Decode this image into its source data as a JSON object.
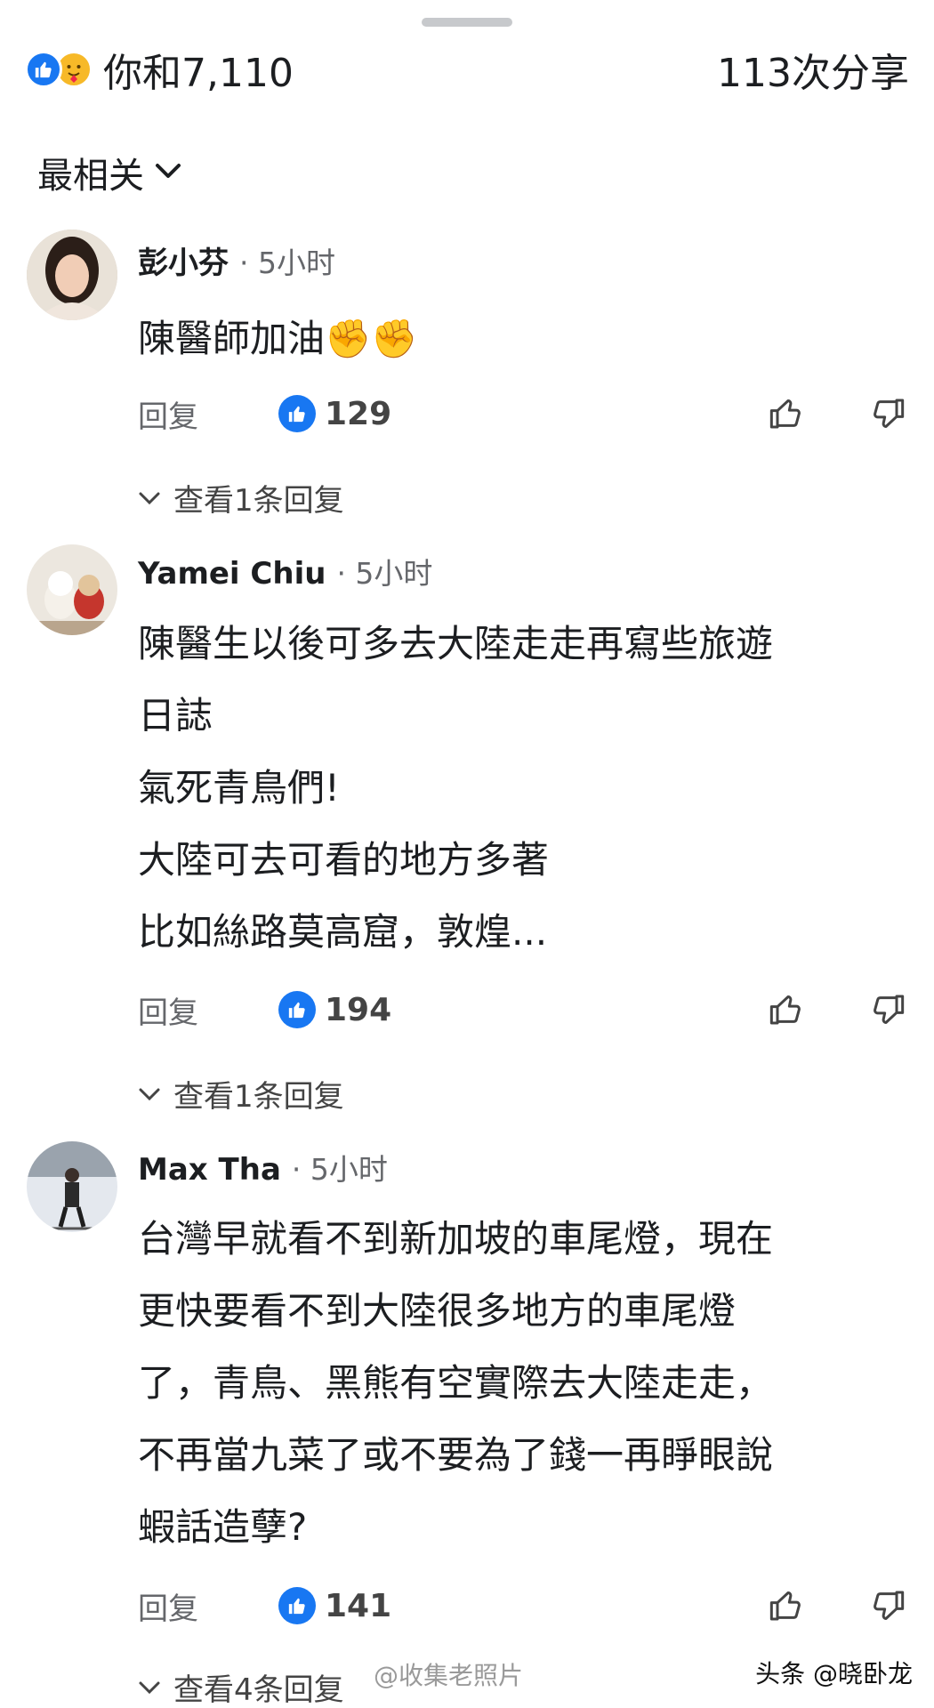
{
  "header": {
    "reaction_text": "你和7,110",
    "shares": "113次分享",
    "like_icon": "thumbs-up-icon",
    "care_icon": "care-emoji-icon"
  },
  "sort": {
    "label": "最相关",
    "icon": "chevron-down-icon"
  },
  "comments": [
    {
      "author": "彭小芬",
      "time": "· 5小时",
      "lines": [
        "陳醫師加油✊✊"
      ],
      "reply_label": "回复",
      "likes": "129",
      "view_replies": "查看1条回复"
    },
    {
      "author": "Yamei Chiu",
      "time": "· 5小时",
      "lines": [
        "陳醫生以後可多去大陸走走再寫些旅遊",
        "日誌",
        "氣死青鳥們!",
        "大陸可去可看的地方多著",
        "比如絲路莫高窟，敦煌..."
      ],
      "reply_label": "回复",
      "likes": "194",
      "view_replies": "查看1条回复"
    },
    {
      "author": "Max Tha",
      "time": "· 5小时",
      "lines": [
        "台灣早就看不到新加坡的車尾燈，現在",
        "更快要看不到大陸很多地方的車尾燈",
        "了，青鳥、黑熊有空實際去大陸走走，",
        "不再當九菜了或不要為了錢一再睜眼說",
        "蝦話造孽?"
      ],
      "reply_label": "回复",
      "likes": "141",
      "view_replies": "查看4条回复"
    }
  ],
  "watermark": {
    "center": "@收集老照片",
    "right": "头条 @晓卧龙"
  },
  "colors": {
    "accent": "#1877f2",
    "text": "#1c1e21",
    "muted": "#65676b"
  }
}
